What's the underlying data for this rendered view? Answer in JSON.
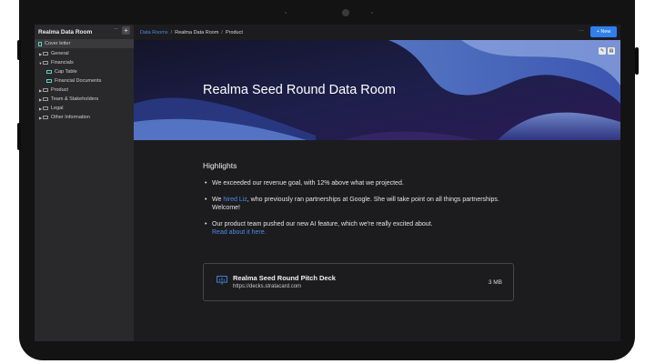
{
  "sidebar": {
    "title": "Realma Data Room",
    "more_label": "···",
    "add_label": "+",
    "items": [
      {
        "label": "Cover letter"
      },
      {
        "label": "General"
      },
      {
        "label": "Financials"
      },
      {
        "label": "Cap Table"
      },
      {
        "label": "Financial Documents"
      },
      {
        "label": "Product"
      },
      {
        "label": "Team & Stakeholders"
      },
      {
        "label": "Legal"
      },
      {
        "label": "Other Information"
      }
    ]
  },
  "topbar": {
    "breadcrumb": [
      "Data Rooms",
      "Realma Data Room",
      "Product"
    ],
    "more_label": "···",
    "new_button": "+ New"
  },
  "banner": {
    "title": "Realma Seed Round Data Room"
  },
  "content": {
    "heading": "Highlights",
    "bullet1": "We exceeded our revenue goal, with 12% above what we projected.",
    "bullet2_pre": "We ",
    "bullet2_link": "hired Liz",
    "bullet2_post": ", who previously ran partnerships at Google. She will take point on all things partnerships. Welcome!",
    "bullet3_text": "Our product team pushed our new AI feature, which we're really excited about.",
    "bullet3_link": "Read about it here."
  },
  "card": {
    "title": "Realma Seed Round Pitch Deck",
    "url": "https://decks.stratacard.com",
    "size": "3 MB"
  },
  "colors": {
    "accent": "#2f7ff2",
    "link": "#4a8be8",
    "folder_highlight": "#5ed1c3"
  }
}
